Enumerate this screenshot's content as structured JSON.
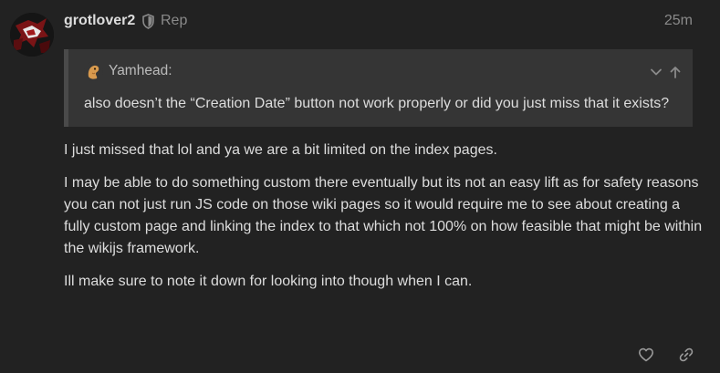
{
  "post": {
    "username": "grotlover2",
    "role": "Rep",
    "timestamp": "25m",
    "quote": {
      "author": "Yamhead:",
      "text": "also doesn’t the “Creation Date” button not work properly or did you just miss that it exists?"
    },
    "paragraphs": [
      "I just missed that lol and ya we are a bit limited on the index pages.",
      "I may be able to do something custom there eventually but its not an easy lift as for safety reasons you can not just run JS code on those wiki pages so it would require me to see about creating a fully custom page and linking the index to that which not 100% on how feasible that might be within the wikijs framework.",
      "Ill make sure to note it down for looking into though when I can."
    ]
  },
  "icons": {
    "role": "shield-icon",
    "quote_expand": "chevron-down-icon",
    "quote_jump": "arrow-up-icon",
    "like": "heart-icon",
    "share": "link-icon"
  }
}
